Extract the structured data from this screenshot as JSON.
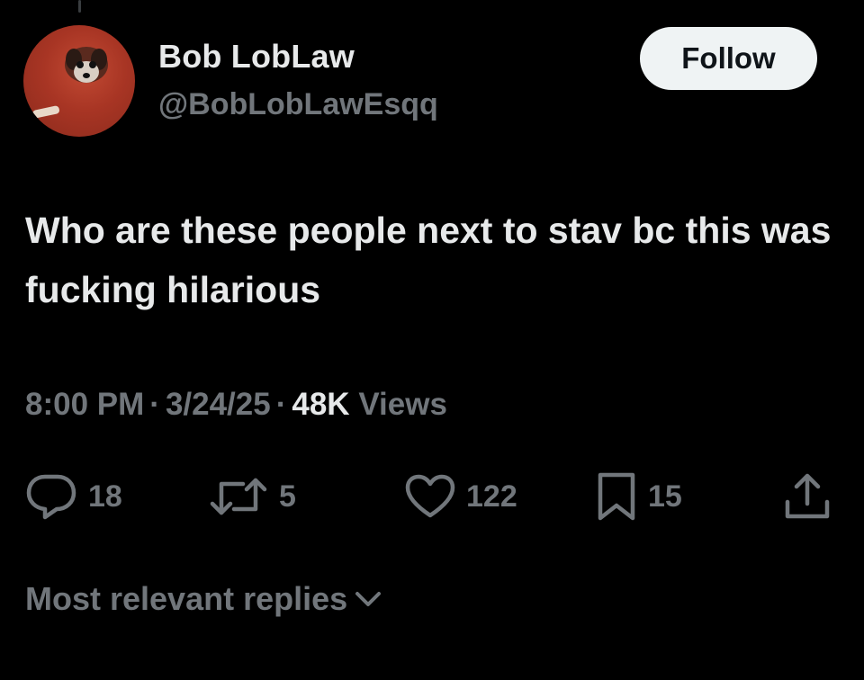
{
  "tweet": {
    "author": {
      "display_name": "Bob LobLaw",
      "handle": "@BobLobLawEsqq",
      "avatar_icon": "dog-peeking-avatar"
    },
    "follow_label": "Follow",
    "text": "Who are these people next to stav bc this was fucking hilarious",
    "time": "8:00 PM",
    "date": "3/24/25",
    "views_count": "48K",
    "views_label": "Views",
    "separator": "·"
  },
  "actions": {
    "reply": {
      "icon": "reply-icon",
      "count": "18"
    },
    "repost": {
      "icon": "repost-icon",
      "count": "5"
    },
    "like": {
      "icon": "heart-icon",
      "count": "122"
    },
    "bookmark": {
      "icon": "bookmark-icon",
      "count": "15"
    },
    "share": {
      "icon": "share-icon"
    }
  },
  "replies_sort": {
    "label": "Most relevant replies",
    "icon": "chevron-down-icon"
  },
  "colors": {
    "background": "#000000",
    "primary_text": "#e7e9ea",
    "secondary_text": "#71767b",
    "follow_button_bg": "#eff3f4"
  }
}
